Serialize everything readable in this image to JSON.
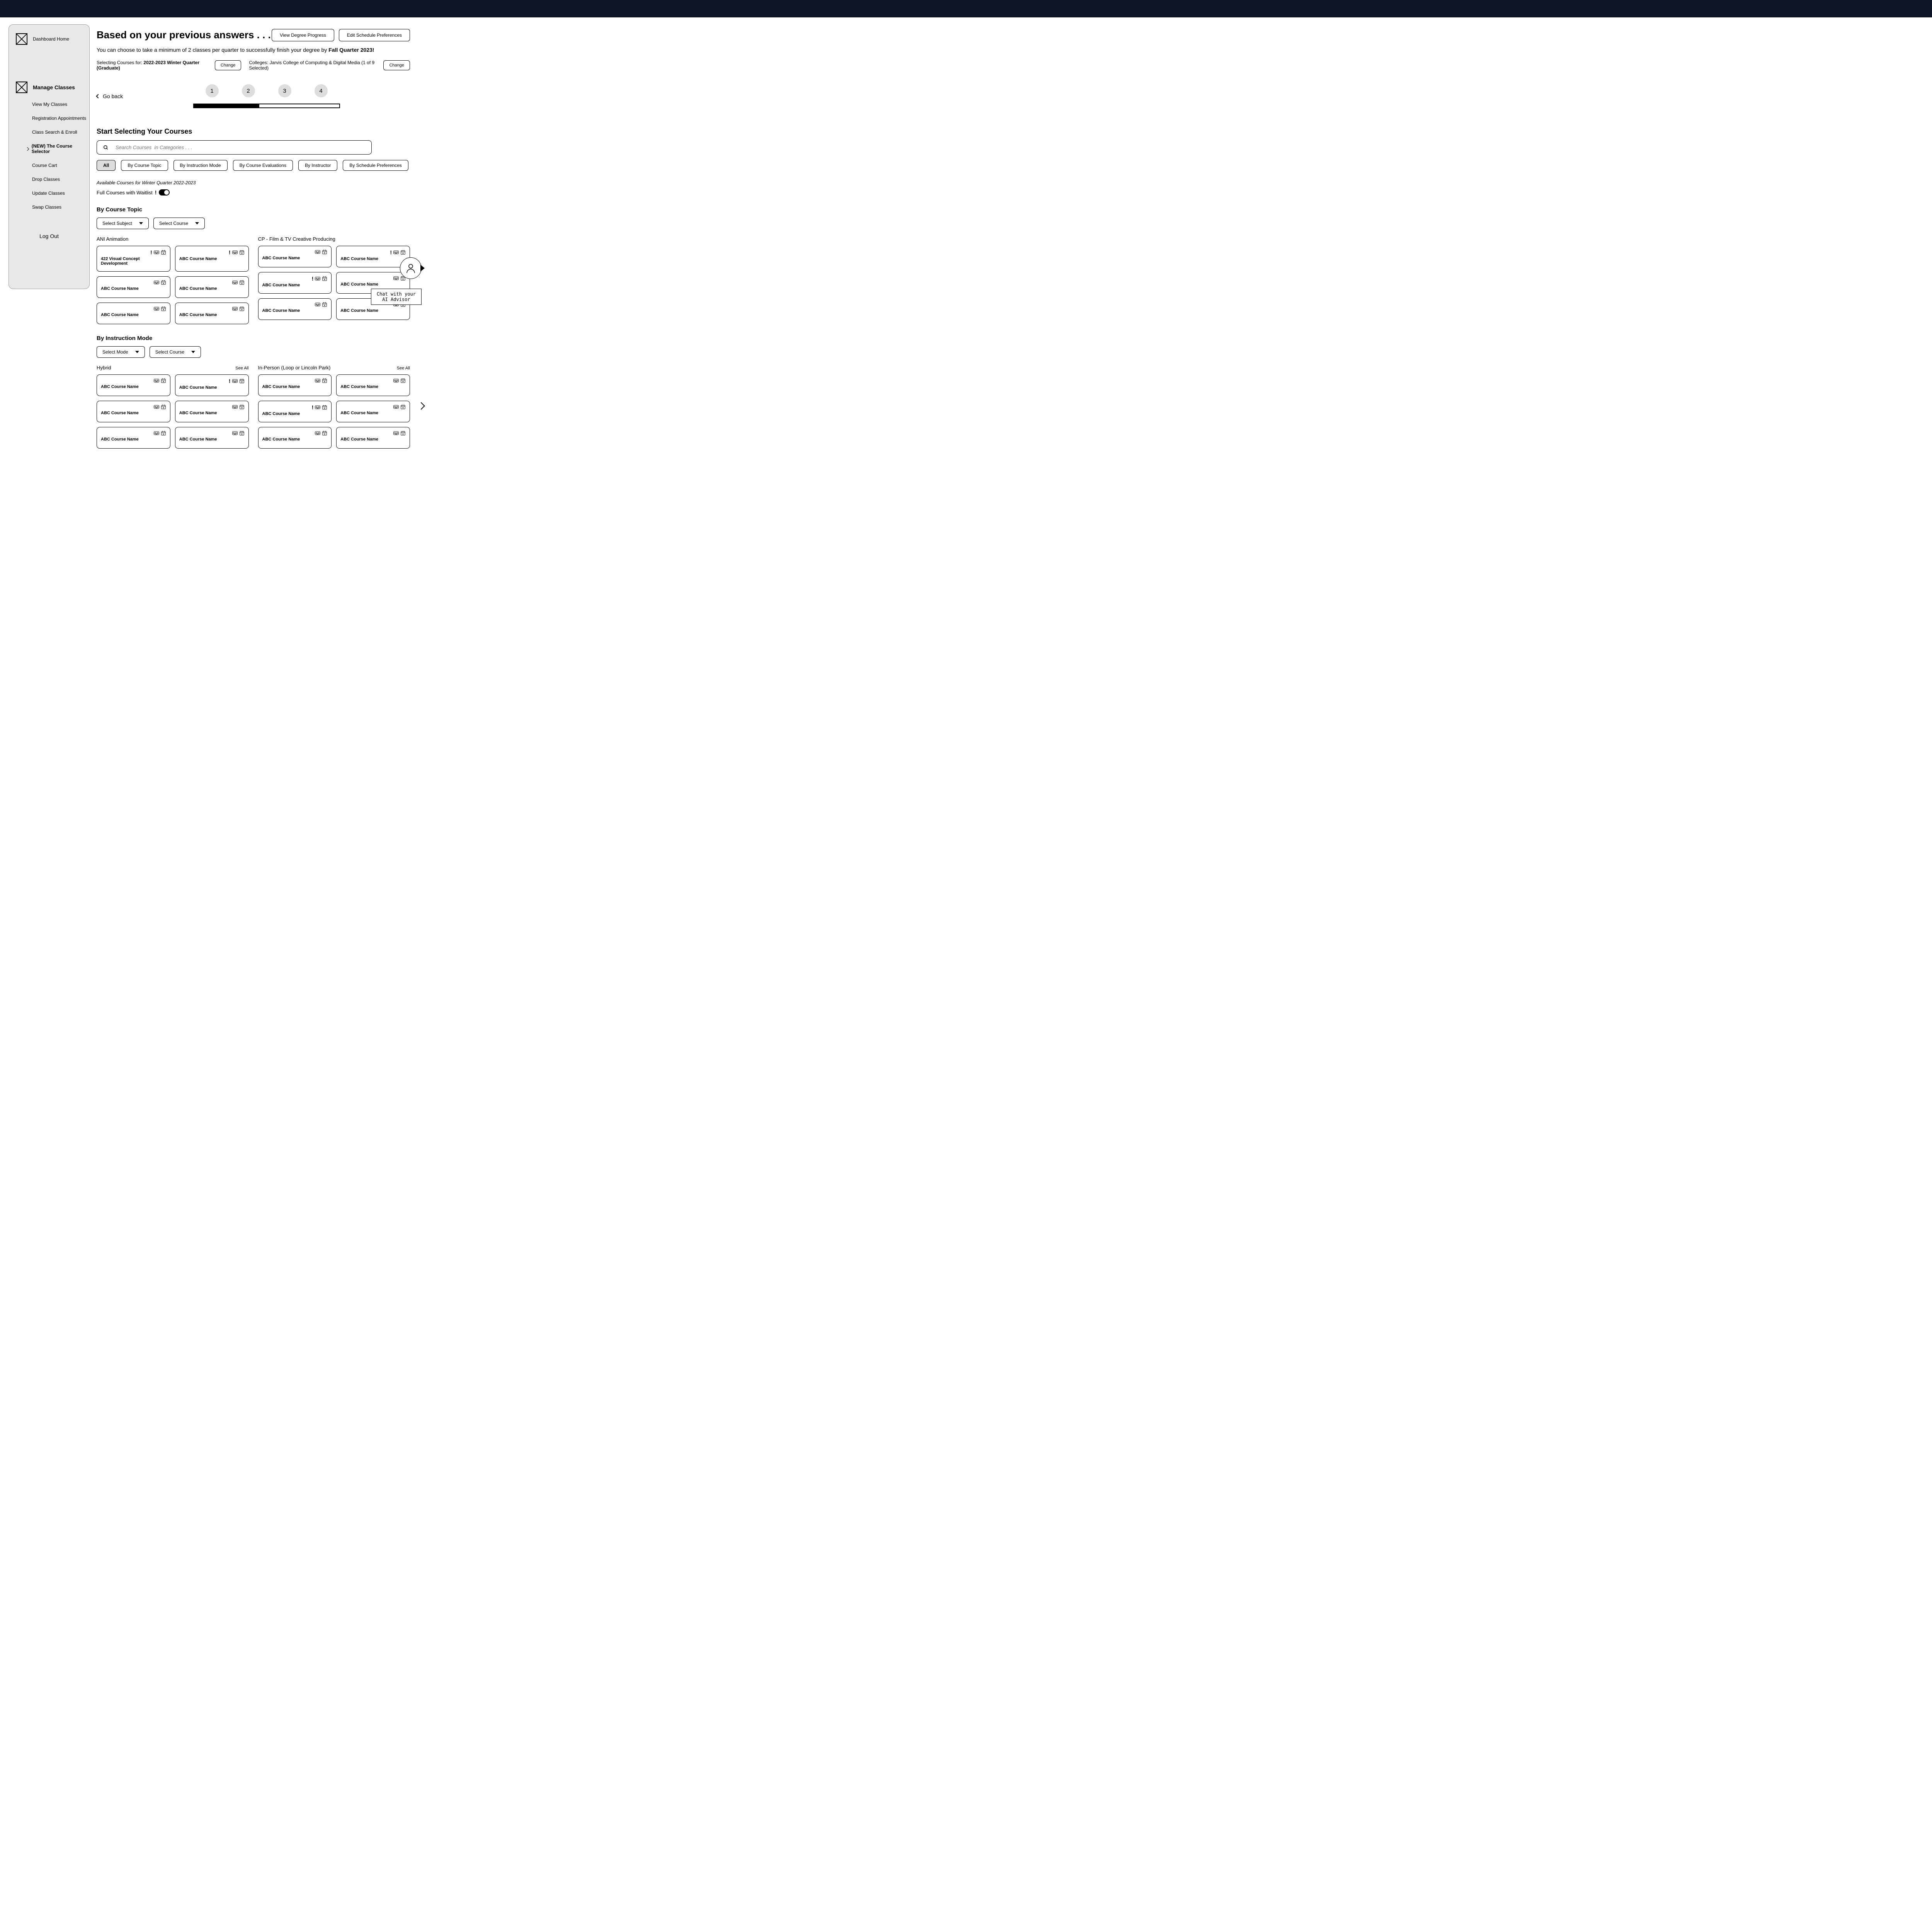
{
  "sidebar": {
    "home": "Dashboard Home",
    "manage": "Manage Classes",
    "items": [
      "View My Classes",
      "Registration Appointments",
      "Class Search & Enroll",
      "(NEW) The Course Selector",
      "Course Cart",
      "Drop Classes",
      "Update Classes",
      "Swap Classes"
    ],
    "logout": "Log Out"
  },
  "header": {
    "title": "Based on your previous answers . . .",
    "btn_progress": "View Degree Progress",
    "btn_prefs": "Edit Schedule Preferences",
    "sub_pre": "You can choose to take a minimum of 2 classes per quarter to successfully finish your degree by ",
    "sub_bold": "Fall Quarter 2023!"
  },
  "selecting": {
    "label_pre": "Selecting Courses for: ",
    "label_bold": "2022-2023 Winter Quarter (Graduate)",
    "change": "Change",
    "colleges": "Colleges: Jarvis College of Computing & Digital Media (1 of 9 Selected)"
  },
  "back": "Go back",
  "steps": [
    "1",
    "2",
    "3",
    "4"
  ],
  "progress_pct": 45,
  "section": {
    "title": "Start Selecting Your Courses",
    "search_placeholder": "Search Courses  in Categories . . .",
    "filters": [
      "All",
      "By Course Topic",
      "By Instruction Mode",
      "By Course Evaluations",
      "By Instructor",
      "By Schedule Preferences"
    ],
    "available": "Available Courses for Winter Quarter 2022-2023",
    "waitlist": "Full Courses with Waitlist"
  },
  "topic": {
    "title": "By Course Topic",
    "dd_subject": "Select Subject",
    "dd_course": "Select Course",
    "col1_title": "ANI Animation",
    "col2_title": "CP - Film & TV Creative Producing",
    "col1_cards": [
      {
        "title": "422 Visual Concept Development",
        "alert": true,
        "vr": true,
        "cal": true
      },
      {
        "title": "ABC Course Name",
        "alert": true,
        "vr": true,
        "cal": true
      },
      {
        "title": "ABC Course Name",
        "alert": false,
        "vr": true,
        "cal": true
      },
      {
        "title": "ABC Course Name",
        "alert": false,
        "vr": true,
        "cal": true
      },
      {
        "title": "ABC Course Name",
        "alert": false,
        "vr": true,
        "cal": true
      },
      {
        "title": "ABC Course Name",
        "alert": false,
        "vr": true,
        "cal": true
      }
    ],
    "col2_cards": [
      {
        "title": "ABC Course Name",
        "alert": false,
        "vr": true,
        "cal": true
      },
      {
        "title": "ABC Course Name",
        "alert": true,
        "vr": true,
        "cal": true
      },
      {
        "title": "ABC Course Name",
        "alert": true,
        "vr": true,
        "cal": true
      },
      {
        "title": "ABC Course Name",
        "alert": false,
        "vr": true,
        "cal": true
      },
      {
        "title": "ABC Course Name",
        "alert": false,
        "vr": true,
        "cal": true
      },
      {
        "title": "ABC Course Name",
        "alert": false,
        "vr": true,
        "cal": true
      }
    ]
  },
  "mode": {
    "title": "By Instruction Mode",
    "dd_mode": "Select Mode",
    "dd_course": "Select Course",
    "col1_title": "Hybrid",
    "col2_title": "In-Person (Loop or Lincoln Park)",
    "see_all": "See All",
    "col1_cards": [
      {
        "title": "ABC Course Name",
        "alert": false,
        "vr": true,
        "cal": true
      },
      {
        "title": "ABC Course Name",
        "alert": true,
        "vr": true,
        "cal": true
      },
      {
        "title": "ABC Course Name",
        "alert": false,
        "vr": true,
        "cal": true
      },
      {
        "title": "ABC Course Name",
        "alert": false,
        "vr": true,
        "cal": true
      },
      {
        "title": "ABC Course Name",
        "alert": false,
        "vr": true,
        "cal": true
      },
      {
        "title": "ABC Course Name",
        "alert": false,
        "vr": true,
        "cal": true
      }
    ],
    "col2_cards": [
      {
        "title": "ABC Course Name",
        "alert": false,
        "vr": true,
        "cal": true
      },
      {
        "title": "ABC Course Name",
        "alert": false,
        "vr": true,
        "cal": true
      },
      {
        "title": "ABC Course Name",
        "alert": true,
        "vr": true,
        "cal": true
      },
      {
        "title": "ABC Course Name",
        "alert": false,
        "vr": true,
        "cal": true
      },
      {
        "title": "ABC Course Name",
        "alert": false,
        "vr": true,
        "cal": true
      },
      {
        "title": "ABC Course Name",
        "alert": false,
        "vr": true,
        "cal": true
      }
    ]
  },
  "chat": {
    "line1": "Chat with your",
    "line2": "AI Advisor"
  }
}
